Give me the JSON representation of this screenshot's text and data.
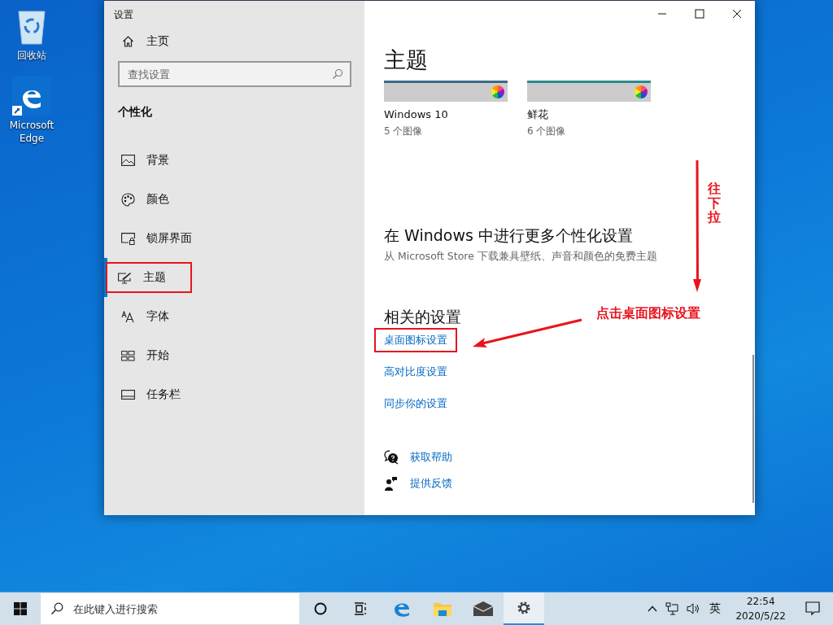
{
  "desktop_icons": [
    {
      "kind": "recycle-bin",
      "label": "回收站"
    },
    {
      "kind": "edge",
      "label": "Microsoft Edge"
    }
  ],
  "window": {
    "title": "设置",
    "sidebar": {
      "home": "主页",
      "search": {
        "placeholder": "查找设置"
      },
      "section": "个性化",
      "items": [
        {
          "kind": "picture",
          "label": "背景",
          "selected": false,
          "highlighted": false
        },
        {
          "kind": "palette",
          "label": "颜色",
          "selected": false,
          "highlighted": false
        },
        {
          "kind": "lock-screen",
          "label": "锁屏界面",
          "selected": false,
          "highlighted": false
        },
        {
          "kind": "theme",
          "label": "主题",
          "selected": true,
          "highlighted": true
        },
        {
          "kind": "font",
          "label": "字体",
          "selected": false,
          "highlighted": false
        },
        {
          "kind": "start",
          "label": "开始",
          "selected": false,
          "highlighted": false
        },
        {
          "kind": "taskbar",
          "label": "任务栏",
          "selected": false,
          "highlighted": false
        }
      ]
    },
    "content": {
      "heading": "主题",
      "themes": [
        {
          "name": "Windows 10",
          "count": "5 个图像",
          "color": "#3a6a8a"
        },
        {
          "name": "鲜花",
          "count": "6 个图像",
          "color": "#2a8a8e"
        }
      ],
      "more": {
        "heading": "在 Windows 中进行更多个性化设置",
        "description": "从 Microsoft Store 下载兼具壁纸、声音和颜色的免费主题"
      },
      "related": {
        "heading": "相关的设置",
        "links": [
          {
            "label": "桌面图标设置",
            "highlighted": true
          },
          {
            "label": "高对比度设置",
            "highlighted": false
          },
          {
            "label": "同步你的设置",
            "highlighted": false
          }
        ]
      },
      "help_links": [
        {
          "kind": "help",
          "label": "获取帮助"
        },
        {
          "kind": "feedback",
          "label": "提供反馈"
        }
      ]
    }
  },
  "annotations": {
    "scroll_hint": "往下拉",
    "click_hint": "点击桌面图标设置"
  },
  "taskbar": {
    "search": {
      "placeholder": "在此键入进行搜索"
    },
    "apps": [
      {
        "kind": "cortana",
        "active": false
      },
      {
        "kind": "task-view",
        "active": false
      },
      {
        "kind": "edge",
        "active": false
      },
      {
        "kind": "file-explorer",
        "active": false
      },
      {
        "kind": "mail",
        "active": false
      },
      {
        "kind": "settings",
        "active": true
      }
    ],
    "tray": {
      "input_method": "英",
      "time": "22:54",
      "date": "2020/5/22"
    }
  }
}
